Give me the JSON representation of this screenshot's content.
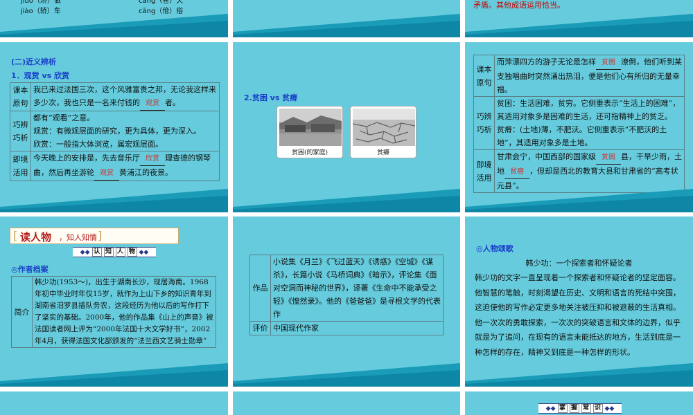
{
  "top_row": {
    "left_line1": "jiǔo（矫）做",
    "left_line1b": "cāng（苍）天",
    "left_line2": "jiào（轿）车",
    "left_line2b": "cāng（伧）俗",
    "right_text": "矛盾。其他成语运用恰当。"
  },
  "slide_synonym": {
    "heading": "(二)近义辨析",
    "sub": "1．观赏 vs 欣赏",
    "rows": [
      {
        "label": "课本原句",
        "text_a": "我已来过法国三次，这个风雅富贵之邦，无论我这样来多少次，我也只是一名来付钱的",
        "answer": "观赏",
        "text_b": "者。"
      },
      {
        "label": "巧辨巧析",
        "lines": [
          "都有“观看”之意。",
          "观赏：有微观层面的研究，更为具体，更为深入。",
          "欣赏：一般指大体浏览，属宏观层面。"
        ]
      },
      {
        "label": "即境活用",
        "text_a": "今天晚上的安排是，先去音乐厅",
        "answer1": "欣赏",
        "text_b": "理查德的钢琴曲，然后再坐游轮",
        "answer2": "观赏",
        "text_c": "黄浦江的夜景。"
      }
    ]
  },
  "slide_poverty": {
    "sub": "2.贫困 vs 贫瘠",
    "photo1_caption": "贫困(的家庭)",
    "photo2_caption": "贫瘠"
  },
  "slide_poverty_table": {
    "rows": [
      {
        "label": "课本原句",
        "text_a": "而萍漂四方的游子无论是怎样",
        "answer": "贫困",
        "text_b": "潦倒，他们听到某支独唱曲时突然涌出热泪，便是他们心有所归的无量幸福。"
      },
      {
        "label": "巧辨巧析",
        "lines": [
          "贫困：生活困难，贫穷。它侧重表示“生活上的困难”，其适用对象多是困难的生活，还可指精神上的贫乏。",
          "贫瘠：(土地)薄，不肥沃。它侧重表示“不肥沃的土地”，其适用对象多是土地。"
        ]
      },
      {
        "label": "即境活用",
        "text_a": "甘肃会宁，中国西部的国家级",
        "answer1": "贫困",
        "text_b": "县，干旱少雨，土地",
        "answer2": "贫瘠",
        "text_c": "，但却是西北的教育大县和甘肃省的“高考状元县”。"
      }
    ]
  },
  "slide_author": {
    "header_title": "读人物",
    "header_sub": "，知人知情",
    "bar_chars": [
      "认",
      "知",
      "人",
      "物"
    ],
    "section": "◎作者档案",
    "label": "简介",
    "intro": "韩少功(1953～)，出生于湖南长沙，现居海南。1968年初中毕业时年仅15岁，就作为上山下乡的知识青年到湖南省汨罗县插队务农，这段经历为他以后的写作打下了坚实的基础。2000年，他的作品集《山上的声音》被法国读者网上评为“2000年法国十大文学好书”，2002年4月，获得法国文化部颁发的“法兰西文艺骑士勋章”"
  },
  "slide_works": {
    "rows": [
      {
        "label": "作品",
        "text": "小说集《月兰》《飞过蓝天》《诱惑》《空城》《谋杀》，长篇小说《马桥词典》《暗示》，评论集《面对空洞而神秘的世界》，译著《生命中不能承受之轻》《惶然录》。他的《爸爸爸》是寻根文学的代表作"
      },
      {
        "label": "评价",
        "text": "中国现代作家"
      }
    ]
  },
  "slide_praise": {
    "section": "◎人物颂歌",
    "title": "韩少功：一个探索者和怀疑论者",
    "body": "韩少功的文字一直呈现着一个探索者和怀疑论者的坚定面容。他智慧的笔触，时刻渴望在历史、文明和语言的死结中突围，这迫使他的写作必定更多地关注被压抑和被遮蔽的生活真相。他一次次的勇敢探索，一次次的突破语言和文体的边界，似乎就是为了追问，在现有的语言未能抵达的地方，生活到底是一种怎样的存在，精神又到底是一种怎样的形状。"
  },
  "bottom_bar": {
    "chars": [
      "掌",
      "握",
      "常",
      "识"
    ]
  },
  "colors": {
    "slide_bg": "#66ccdd",
    "band_dark": "#1a9bb8",
    "answer": "#cc3333",
    "heading": "#1a3fc9"
  }
}
